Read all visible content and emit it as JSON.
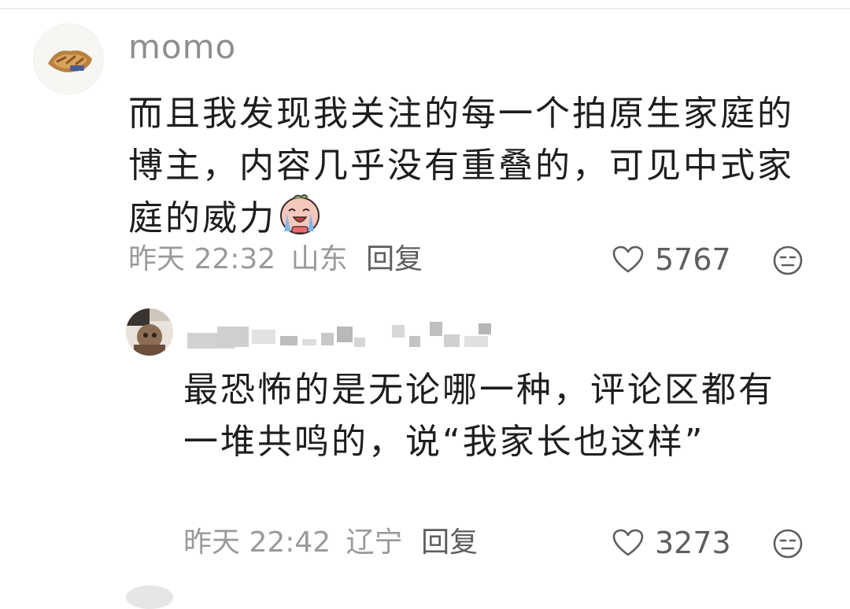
{
  "comments": [
    {
      "username": "momo",
      "content": "而且我发现我关注的每一个拍原生家庭的博主，内容几乎没有重叠的，可见中式家庭的威力",
      "emoji": "crying-laughing-sticker-icon",
      "time": "昨天 22:32",
      "location": "山东",
      "reply_label": "回复",
      "likes": "5767",
      "reaction_icon": "neutral-face-icon"
    },
    {
      "username": "",
      "username_blurred": true,
      "content": "最恐怖的是无论哪一种，评论区都有一堆共鸣的，说“我家长也这样”",
      "time": "昨天 22:42",
      "location": "辽宁",
      "reply_label": "回复",
      "likes": "3273",
      "reaction_icon": "neutral-face-icon"
    }
  ],
  "colors": {
    "text_primary": "#1e1e1e",
    "text_secondary": "#9a9a9a",
    "icon": "#5e5e5e"
  }
}
